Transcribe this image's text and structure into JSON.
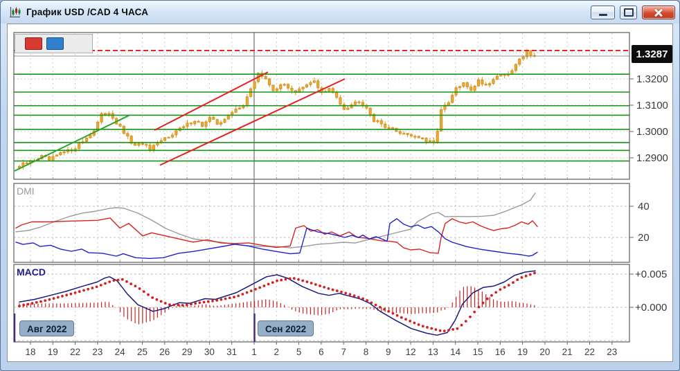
{
  "window": {
    "title": "График USD /CAD  4 ЧАСА",
    "controls": [
      "minimize",
      "maximize",
      "close"
    ]
  },
  "toolbar": {
    "buttons": [
      {
        "name": "red-marker",
        "color": "#d63a31"
      },
      {
        "name": "blue-marker",
        "color": "#2f81cd"
      }
    ]
  },
  "chart_data": {
    "type": "candlestick",
    "symbol_title": "График USD /CAD 4 ЧАСА",
    "timeframe": "4 hours",
    "current_price_label": "1.3287",
    "current_price": 1.3287,
    "x_labels": [
      "18",
      "19",
      "22",
      "23",
      "24",
      "25",
      "26",
      "29",
      "30",
      "31",
      "1",
      "2",
      "5",
      "6",
      "7",
      "8",
      "9",
      "12",
      "13",
      "14",
      "15",
      "16",
      "19",
      "20",
      "21",
      "22",
      "23"
    ],
    "month_markers": [
      {
        "label": "Авг 2022",
        "x_label_index": 0
      },
      {
        "label": "Сен 2022",
        "x_label_index": 10
      }
    ],
    "price_axis": {
      "tick_labels": [
        "1.3200",
        "1.3100",
        "1.3000",
        "1.2900"
      ],
      "tick_values": [
        1.32,
        1.31,
        1.3,
        1.29
      ],
      "grid_values": [
        1.33,
        1.32,
        1.31,
        1.3,
        1.29
      ]
    },
    "red_resistance_level": 1.3308,
    "green_levels": [
      1.3218,
      1.315,
      1.3098,
      1.3062,
      1.3008,
      1.2958,
      1.2928,
      1.2888
    ],
    "trendlines": [
      {
        "color": "#28a428",
        "x1": 20,
        "p1": 1.285,
        "x2": 186,
        "p2": 1.3062
      },
      {
        "color": "#e42222",
        "x1": 222,
        "p1": 1.3005,
        "x2": 386,
        "p2": 1.3226
      },
      {
        "color": "#e42222",
        "x1": 230,
        "p1": 1.2872,
        "x2": 497,
        "p2": 1.32
      }
    ],
    "bars_per_day": 6,
    "num_bars": 139,
    "price_anchors": [
      [
        0,
        1.2868
      ],
      [
        3,
        1.2886
      ],
      [
        6,
        1.2905
      ],
      [
        8,
        1.2891
      ],
      [
        11,
        1.2916
      ],
      [
        14,
        1.293
      ],
      [
        17,
        1.2964
      ],
      [
        20,
        1.3004
      ],
      [
        22,
        1.3062
      ],
      [
        24,
        1.3074
      ],
      [
        26,
        1.3032
      ],
      [
        29,
        1.2976
      ],
      [
        31,
        1.2942
      ],
      [
        33,
        1.2956
      ],
      [
        35,
        1.293
      ],
      [
        38,
        1.2964
      ],
      [
        41,
        1.2994
      ],
      [
        44,
        1.3018
      ],
      [
        47,
        1.3044
      ],
      [
        49,
        1.3022
      ],
      [
        51,
        1.305
      ],
      [
        53,
        1.303
      ],
      [
        56,
        1.3058
      ],
      [
        58,
        1.3084
      ],
      [
        60,
        1.3104
      ],
      [
        62,
        1.3158
      ],
      [
        64,
        1.3224
      ],
      [
        66,
        1.3196
      ],
      [
        68,
        1.316
      ],
      [
        71,
        1.3178
      ],
      [
        74,
        1.315
      ],
      [
        77,
        1.3174
      ],
      [
        79,
        1.3194
      ],
      [
        81,
        1.3146
      ],
      [
        83,
        1.316
      ],
      [
        85,
        1.313
      ],
      [
        87,
        1.3088
      ],
      [
        89,
        1.3104
      ],
      [
        91,
        1.3118
      ],
      [
        93,
        1.3094
      ],
      [
        95,
        1.3042
      ],
      [
        98,
        1.3022
      ],
      [
        101,
        1.3
      ],
      [
        104,
        1.299
      ],
      [
        107,
        1.2978
      ],
      [
        109,
        1.2962
      ],
      [
        111,
        1.2956
      ],
      [
        112,
        1.3008
      ],
      [
        113,
        1.3082
      ],
      [
        115,
        1.3108
      ],
      [
        117,
        1.3164
      ],
      [
        119,
        1.318
      ],
      [
        121,
        1.316
      ],
      [
        123,
        1.3194
      ],
      [
        125,
        1.3176
      ],
      [
        127,
        1.32
      ],
      [
        129,
        1.322
      ],
      [
        131,
        1.3212
      ],
      [
        133,
        1.3254
      ],
      [
        135,
        1.329
      ],
      [
        136,
        1.3312
      ],
      [
        137,
        1.3287
      ],
      [
        138,
        1.3292
      ]
    ],
    "indicators": {
      "dmi": {
        "label": "DMI",
        "y_ticks": [
          "40",
          "20"
        ],
        "y_tick_values": [
          40,
          20
        ],
        "plus_di": [
          [
            22,
            26
          ],
          [
            30,
            28
          ],
          [
            45,
            30
          ],
          [
            70,
            30
          ],
          [
            100,
            30.5
          ],
          [
            140,
            31
          ],
          [
            158,
            32.5
          ],
          [
            172,
            26
          ],
          [
            185,
            29
          ],
          [
            205,
            21
          ],
          [
            218,
            23
          ],
          [
            238,
            21
          ],
          [
            258,
            19
          ],
          [
            278,
            17
          ],
          [
            298,
            18.5
          ],
          [
            318,
            16.5
          ],
          [
            338,
            16
          ],
          [
            358,
            16.5
          ],
          [
            378,
            15
          ],
          [
            398,
            13.5
          ],
          [
            418,
            14.5
          ],
          [
            426,
            26
          ],
          [
            438,
            27.5
          ],
          [
            448,
            24
          ],
          [
            458,
            25
          ],
          [
            468,
            22
          ],
          [
            478,
            23.5
          ],
          [
            490,
            21
          ],
          [
            503,
            23.5
          ],
          [
            515,
            20
          ],
          [
            528,
            19.5
          ],
          [
            538,
            18.7
          ],
          [
            550,
            17.8
          ],
          [
            562,
            17.5
          ],
          [
            572,
            16.9
          ],
          [
            582,
            13.3
          ],
          [
            592,
            12
          ],
          [
            605,
            12.5
          ],
          [
            620,
            10.2
          ],
          [
            632,
            9.8
          ],
          [
            636,
            20
          ],
          [
            642,
            29
          ],
          [
            652,
            32
          ],
          [
            662,
            30
          ],
          [
            672,
            29
          ],
          [
            682,
            30
          ],
          [
            692,
            27.6
          ],
          [
            702,
            25.8
          ],
          [
            712,
            24.4
          ],
          [
            722,
            25.5
          ],
          [
            732,
            26
          ],
          [
            742,
            27.6
          ],
          [
            752,
            30
          ],
          [
            762,
            28.5
          ],
          [
            768,
            30.7
          ],
          [
            775,
            27
          ]
        ],
        "minus_di": [
          [
            22,
            17
          ],
          [
            32,
            15.5
          ],
          [
            47,
            16.5
          ],
          [
            57,
            14.2
          ],
          [
            72,
            15
          ],
          [
            87,
            12.4
          ],
          [
            102,
            11.1
          ],
          [
            117,
            12.5
          ],
          [
            127,
            10.2
          ],
          [
            147,
            9.8
          ],
          [
            167,
            8
          ],
          [
            177,
            9.5
          ],
          [
            195,
            7
          ],
          [
            215,
            6.5
          ],
          [
            235,
            7
          ],
          [
            257,
            9.8
          ],
          [
            278,
            11
          ],
          [
            298,
            12.5
          ],
          [
            318,
            14
          ],
          [
            338,
            15.6
          ],
          [
            358,
            14.5
          ],
          [
            378,
            12.5
          ],
          [
            398,
            11
          ],
          [
            418,
            9.5
          ],
          [
            432,
            10
          ],
          [
            442,
            26
          ],
          [
            457,
            23.6
          ],
          [
            477,
            22.2
          ],
          [
            497,
            20
          ],
          [
            507,
            21.3
          ],
          [
            517,
            20
          ],
          [
            523,
            21.5
          ],
          [
            532,
            19
          ],
          [
            542,
            20.5
          ],
          [
            552,
            18.7
          ],
          [
            558,
            17.5
          ],
          [
            562,
            29
          ],
          [
            572,
            32
          ],
          [
            582,
            28.5
          ],
          [
            592,
            26.7
          ],
          [
            602,
            28
          ],
          [
            612,
            25.8
          ],
          [
            622,
            27
          ],
          [
            632,
            23.6
          ],
          [
            642,
            19.1
          ],
          [
            652,
            16.9
          ],
          [
            662,
            15.6
          ],
          [
            672,
            14.2
          ],
          [
            692,
            12.4
          ],
          [
            712,
            11.1
          ],
          [
            732,
            9.8
          ],
          [
            752,
            8.9
          ],
          [
            762,
            8
          ],
          [
            768,
            8.5
          ],
          [
            775,
            10.5
          ]
        ],
        "adx": [
          [
            22,
            23.6
          ],
          [
            40,
            24.5
          ],
          [
            58,
            26.7
          ],
          [
            78,
            30.2
          ],
          [
            98,
            33.3
          ],
          [
            118,
            35.6
          ],
          [
            138,
            36.9
          ],
          [
            158,
            38.7
          ],
          [
            168,
            39.1
          ],
          [
            178,
            38.7
          ],
          [
            198,
            35.6
          ],
          [
            218,
            31.1
          ],
          [
            238,
            25.8
          ],
          [
            258,
            22.2
          ],
          [
            278,
            19.1
          ],
          [
            298,
            17.8
          ],
          [
            318,
            16.9
          ],
          [
            338,
            15.6
          ],
          [
            358,
            14.7
          ],
          [
            378,
            14.2
          ],
          [
            398,
            14.2
          ],
          [
            418,
            13.3
          ],
          [
            438,
            14.2
          ],
          [
            458,
            15.6
          ],
          [
            478,
            16.2
          ],
          [
            495,
            16.9
          ],
          [
            512,
            16.4
          ],
          [
            532,
            18.7
          ],
          [
            552,
            20.9
          ],
          [
            572,
            23.1
          ],
          [
            592,
            25.3
          ],
          [
            602,
            30.2
          ],
          [
            622,
            35.1
          ],
          [
            632,
            36
          ],
          [
            642,
            33.3
          ],
          [
            655,
            33.5
          ],
          [
            675,
            33.4
          ],
          [
            695,
            33.6
          ],
          [
            712,
            34.2
          ],
          [
            732,
            37.3
          ],
          [
            752,
            40.9
          ],
          [
            765,
            44
          ],
          [
            772,
            48.5
          ]
        ]
      },
      "macd": {
        "label": "MACD",
        "y_ticks": [
          "+0.005",
          "+0.000"
        ],
        "y_tick_values": [
          0.005,
          0.0
        ],
        "macd_line": [
          [
            27,
            0.0008
          ],
          [
            49,
            0.0012
          ],
          [
            72,
            0.0018
          ],
          [
            94,
            0.0024
          ],
          [
            116,
            0.0031
          ],
          [
            139,
            0.0038
          ],
          [
            150,
            0.0044
          ],
          [
            157,
            0.0046
          ],
          [
            168,
            0.004
          ],
          [
            183,
            0.002
          ],
          [
            198,
            0.0004
          ],
          [
            220,
            -0.0006
          ],
          [
            236,
            -0.0002
          ],
          [
            258,
            0.0007
          ],
          [
            273,
            0.0006
          ],
          [
            295,
            0.0013
          ],
          [
            310,
            0.0012
          ],
          [
            340,
            0.0022
          ],
          [
            362,
            0.0034
          ],
          [
            384,
            0.0046
          ],
          [
            399,
            0.0049
          ],
          [
            414,
            0.0044
          ],
          [
            436,
            0.0031
          ],
          [
            459,
            0.0021
          ],
          [
            474,
            0.0018
          ],
          [
            489,
            0.0021
          ],
          [
            496,
            0.0019
          ],
          [
            518,
            0.0013
          ],
          [
            533,
            0.0006
          ],
          [
            548,
            -0.0006
          ],
          [
            571,
            -0.002
          ],
          [
            593,
            -0.0032
          ],
          [
            615,
            -0.0039
          ],
          [
            630,
            -0.0042
          ],
          [
            645,
            -0.0038
          ],
          [
            656,
            -0.002
          ],
          [
            667,
            0.0005
          ],
          [
            682,
            0.0022
          ],
          [
            697,
            0.003
          ],
          [
            712,
            0.0032
          ],
          [
            727,
            0.0038
          ],
          [
            742,
            0.0048
          ],
          [
            757,
            0.0053
          ],
          [
            772,
            0.0055
          ]
        ],
        "signal_line": [
          [
            27,
            0.0002
          ],
          [
            64,
            0.001
          ],
          [
            101,
            0.002
          ],
          [
            139,
            0.0031
          ],
          [
            161,
            0.004
          ],
          [
            176,
            0.0042
          ],
          [
            198,
            0.003
          ],
          [
            220,
            0.0014
          ],
          [
            243,
            0.0004
          ],
          [
            265,
            0.0003
          ],
          [
            288,
            0.0007
          ],
          [
            310,
            0.001
          ],
          [
            340,
            0.0016
          ],
          [
            370,
            0.0028
          ],
          [
            399,
            0.004
          ],
          [
            422,
            0.0044
          ],
          [
            444,
            0.0038
          ],
          [
            474,
            0.0028
          ],
          [
            503,
            0.002
          ],
          [
            526,
            0.0012
          ],
          [
            548,
            0.0
          ],
          [
            578,
            -0.0015
          ],
          [
            608,
            -0.0028
          ],
          [
            638,
            -0.0036
          ],
          [
            660,
            -0.0032
          ],
          [
            675,
            -0.0018
          ],
          [
            690,
            0.0
          ],
          [
            705,
            0.0015
          ],
          [
            720,
            0.0026
          ],
          [
            735,
            0.0034
          ],
          [
            750,
            0.0044
          ],
          [
            772,
            0.0052
          ]
        ]
      }
    },
    "colors": {
      "candle": "#eda62f",
      "candle_stroke": "#cf8a15",
      "green_level": "#169616",
      "red_line": "#ee2020",
      "grid": "#c9c9c9",
      "dmi_plus": "#d82222",
      "dmi_minus": "#2222cc",
      "dmi_adx": "#999999",
      "macd_line": "#1a1a7e",
      "macd_signal": "#d42020",
      "macd_hist": "#cc2020",
      "month_line": "#4a2c7d",
      "sep_line": "#6e6e6e",
      "current_price_line": "#909090"
    }
  }
}
